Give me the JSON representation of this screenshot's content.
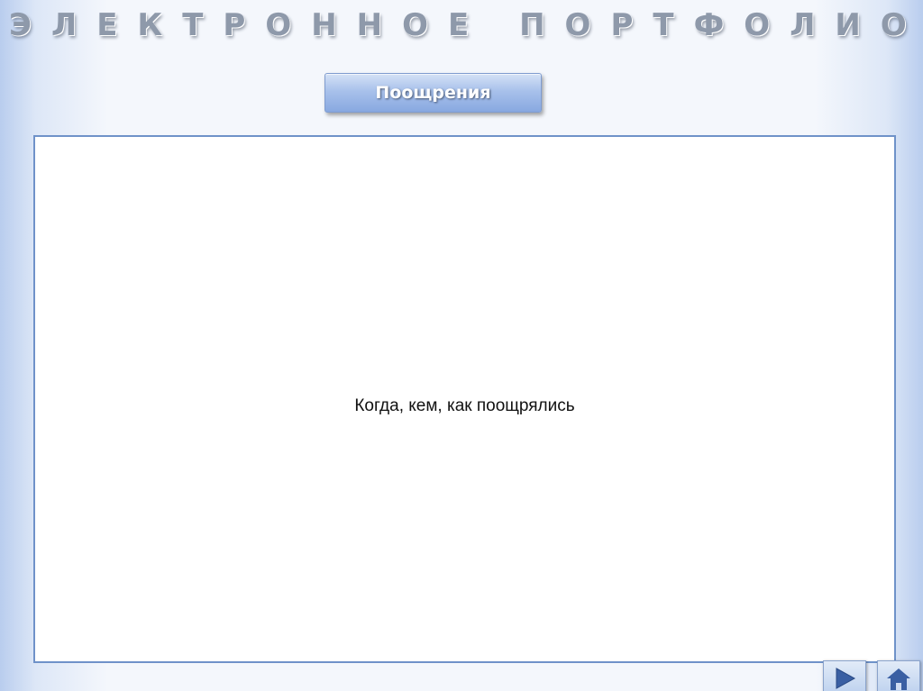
{
  "header": {
    "title": "ЭЛЕКТРОННОЕ ПОРТФОЛИО"
  },
  "section_button": {
    "label": "Поощрения"
  },
  "content": {
    "text": "Когда, кем, как поощрялись"
  },
  "navigation": {
    "next_icon": "play-arrow-icon",
    "home_icon": "home-icon"
  },
  "colors": {
    "accent": "#6f92c9",
    "button_fill": "#a8c1eb",
    "title_text": "#8e99aa"
  }
}
